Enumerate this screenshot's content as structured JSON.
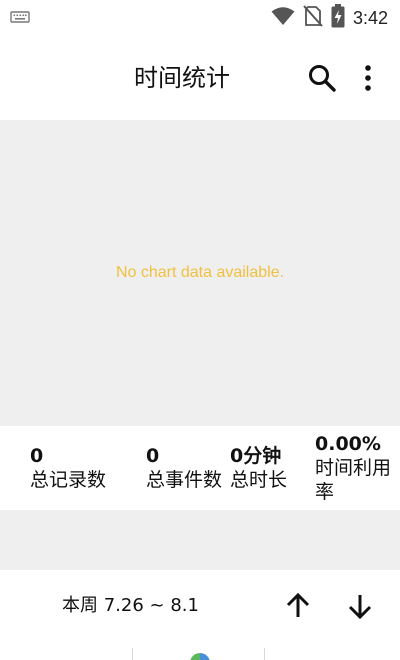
{
  "status_bar": {
    "time": "3:42",
    "icons": [
      "keyboard-icon",
      "wifi-icon",
      "no-sim-icon",
      "battery-charging-icon"
    ]
  },
  "app_bar": {
    "title": "时间统计",
    "actions": [
      "search-icon",
      "more-vert-icon"
    ]
  },
  "chart": {
    "empty_message": "No chart data available.",
    "message_color": "#f0c040",
    "background": "#efefef"
  },
  "stats": [
    {
      "value": "0",
      "label": "总记录数"
    },
    {
      "value": "0",
      "label": "总事件数"
    },
    {
      "value": "0分钟",
      "label": "总时长"
    },
    {
      "value": "0.00%",
      "label": "时间利用率"
    }
  ],
  "period": {
    "label": "本周 7.26 ~ 8.1",
    "actions": [
      "arrow-up-icon",
      "arrow-down-icon"
    ]
  }
}
